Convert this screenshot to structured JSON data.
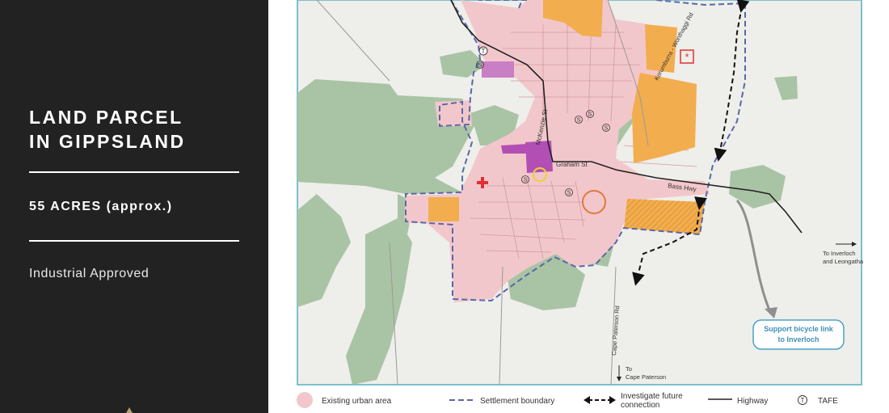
{
  "sidebar": {
    "title_line1": "LAND PARCEL",
    "title_line2": "IN GIPPSLAND",
    "area": "55 ACRES (approx.)",
    "zoning": "Industrial Approved"
  },
  "map": {
    "road_labels": {
      "graham_st": "Graham St",
      "bass_hwy": "Bass Hwy",
      "mckenzie_st": "McKenzie St",
      "korumburra_rd": "Korumburra - Wonthaggi Rd",
      "cape_paterson_rd": "Cape Paterson Rd"
    },
    "to_inverloch_line1": "To Inverloch",
    "to_inverloch_line2": "and Leongatha",
    "to_cape_line1": "To",
    "to_cape_line2": "Cape Paterson",
    "callout_line1": "Support bicycle link",
    "callout_line2": "to Inverloch",
    "school_symbol": "S",
    "tafe_symbol": "T"
  },
  "legend": {
    "urban_area": "Existing urban area",
    "settlement_boundary": "Settlement boundary",
    "future_connection_line1": "Investigate future",
    "future_connection_line2": "connection",
    "highway": "Highway",
    "tafe": "TAFE",
    "tafe_symbol": "T"
  },
  "colors": {
    "sidebar_bg": "#222222",
    "urban_area": "#f2c7cb",
    "green_space": "#a9c4a4",
    "industrial_orange": "#f2ad4e",
    "purple_commercial": "#b34fb4",
    "boundary_blue": "#5a67a8",
    "callout_blue": "#4aa3c8"
  }
}
